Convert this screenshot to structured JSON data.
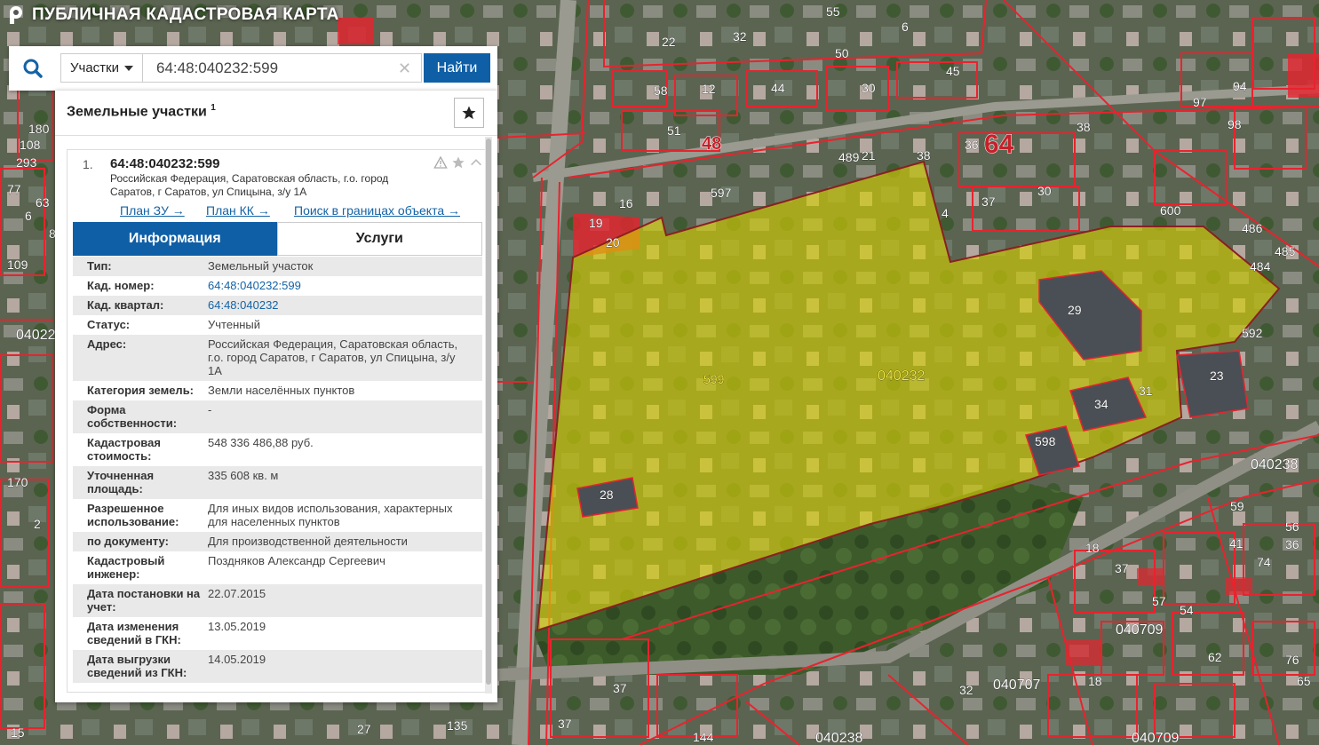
{
  "app": {
    "title": "ПУБЛИЧНАЯ КАДАСТРОВАЯ КАРТА"
  },
  "search": {
    "type_label": "Участки",
    "value": "64:48:040232:599",
    "button_label": "Найти"
  },
  "panel": {
    "title": "Земельные участки",
    "count": "1"
  },
  "result": {
    "index": "1.",
    "cad_number": "64:48:040232:599",
    "address": "Российская Федерация, Саратовская область, г.о. город Саратов, г Саратов, ул Спицына, з/у 1А",
    "links": [
      "План ЗУ →",
      "План КК →",
      "Поиск в границах объекта →"
    ],
    "tabs": {
      "info": "Информация",
      "services": "Услуги"
    }
  },
  "info_rows": [
    {
      "label": "Тип:",
      "value": "Земельный участок"
    },
    {
      "label": "Кад. номер:",
      "value": "64:48:040232:599"
    },
    {
      "label": "Кад. квартал:",
      "value": "64:48:040232"
    },
    {
      "label": "Статус:",
      "value": "Учтенный"
    },
    {
      "label": "Адрес:",
      "value": "Российская Федерация, Саратовская область, г.о. город Саратов, г Саратов, ул Спицына, з/у 1А"
    },
    {
      "label": "Категория земель:",
      "value": "Земли населённых пунктов"
    },
    {
      "label": "Форма собственности:",
      "value": "-"
    },
    {
      "label": "Кадастровая стоимость:",
      "value": "548 336 486,88 руб."
    },
    {
      "label": "Уточненная площадь:",
      "value": "335 608 кв. м"
    },
    {
      "label": "Разрешенное использование:",
      "value": "Для иных видов использования, характерных для населенных пунктов"
    },
    {
      "label": "по документу:",
      "value": "Для производственной деятельности"
    },
    {
      "label": "Кадастровый инженер:",
      "value": "Поздняков Александр Сергеевич"
    },
    {
      "label": "Дата постановки на учет:",
      "value": "22.07.2015"
    },
    {
      "label": "Дата изменения сведений в ГКН:",
      "value": "13.05.2019"
    },
    {
      "label": "Дата выгрузки сведений из ГКН:",
      "value": "14.05.2019"
    }
  ],
  "map": {
    "parcel_label": "599",
    "quarter_label": "040232",
    "quarter_labels": [
      "040238",
      "040709",
      "040707",
      "040709",
      "04022",
      "040238"
    ],
    "building_labels": [
      "55",
      "22",
      "32",
      "50",
      "6",
      "45",
      "58",
      "12",
      "44",
      "30",
      "94",
      "97",
      "98",
      "51",
      "48",
      "36",
      "64",
      "489",
      "21",
      "38",
      "38",
      "597",
      "16",
      "19",
      "20",
      "37",
      "30",
      "4",
      "600",
      "486",
      "485",
      "484",
      "29",
      "592",
      "23",
      "34",
      "31",
      "598",
      "28",
      "59",
      "18",
      "37",
      "41",
      "56",
      "36",
      "74",
      "57",
      "54",
      "62",
      "76",
      "18",
      "65",
      "37",
      "27",
      "144",
      "135",
      "32",
      "180",
      "108",
      "293",
      "77",
      "63",
      "109",
      "170",
      "15",
      "37",
      "88",
      "6",
      "2"
    ],
    "colors": {
      "parcel_fill": "#d9d200",
      "boundary": "#e8232e",
      "selected_outline": "#8a2020"
    }
  }
}
